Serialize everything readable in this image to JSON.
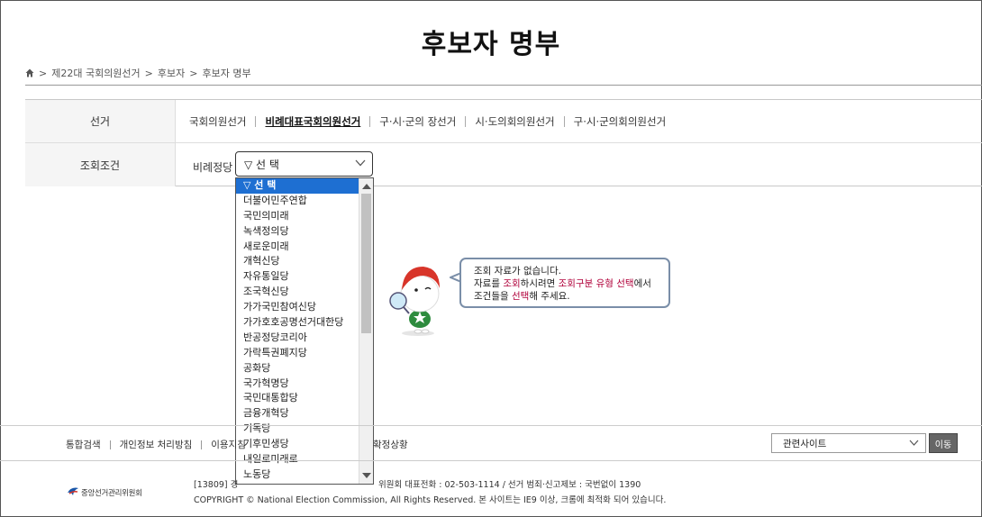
{
  "page_title": "후보자 명부",
  "breadcrumb": [
    "제22대 국회의원선거",
    "후보자",
    "후보자 명부"
  ],
  "filters": {
    "election_label": "선거",
    "election_tabs": [
      "국회의원선거",
      "비례대표국회의원선거",
      "구·시·군의 장선거",
      "시·도의회의원선거",
      "구·시·군의회의원선거"
    ],
    "active_tab_index": 1,
    "condition_label": "조회조건",
    "party_label": "비례정당",
    "party_select_value": "▽ 선 택"
  },
  "dropdown_options": [
    "▽ 선 택",
    "더불어민주연합",
    "국민의미래",
    "녹색정의당",
    "새로운미래",
    "개혁신당",
    "자유통일당",
    "조국혁신당",
    "가가국민참여신당",
    "가가호호공명선거대한당",
    "반공정당코리아",
    "가락특권폐지당",
    "공화당",
    "국가혁명당",
    "국민대통합당",
    "금융개혁당",
    "기독당",
    "기후민생당",
    "내일로미래로",
    "노동당"
  ],
  "empty_message": {
    "line1": "조회 자료가 없습니다.",
    "line2_a": "자료를 ",
    "line2_hl1": "조회",
    "line2_b": "하시려면 ",
    "line2_hl2": "조회구분 유형 선택",
    "line2_c": "에서",
    "line3_a": "조건들을 ",
    "line3_hl": "선택",
    "line3_b": "해 주세요."
  },
  "footer": {
    "links": [
      "통합검색",
      "개인정보 처리방침",
      "이용지침"
    ],
    "extra_link": "확정상황",
    "related_sites": "관련사이트",
    "go_button": "이동",
    "org_name": "중앙선거관리위원회",
    "address_prefix": "[13809] 경",
    "address_rest": "위원회 대표전화 : 02-503-1114 / 선거 범죄·신고제보 : 국번없이 1390",
    "copyright": "COPYRIGHT © National Election Commission, All Rights Reserved. 본 사이트는 IE9 이상, 크롬에 최적화 되어 있습니다."
  },
  "colors": {
    "selected_option": "#1e6fd2",
    "highlight_text": "#b0003a",
    "speech_border": "#7a8ea8",
    "mascot_hat": "#d8352a",
    "mascot_body": "#2e8b3e"
  },
  "icons": [
    "home-icon",
    "chevron-down-icon",
    "scroll-up-arrow-icon",
    "scroll-down-arrow-icon",
    "nec-logo-icon"
  ]
}
